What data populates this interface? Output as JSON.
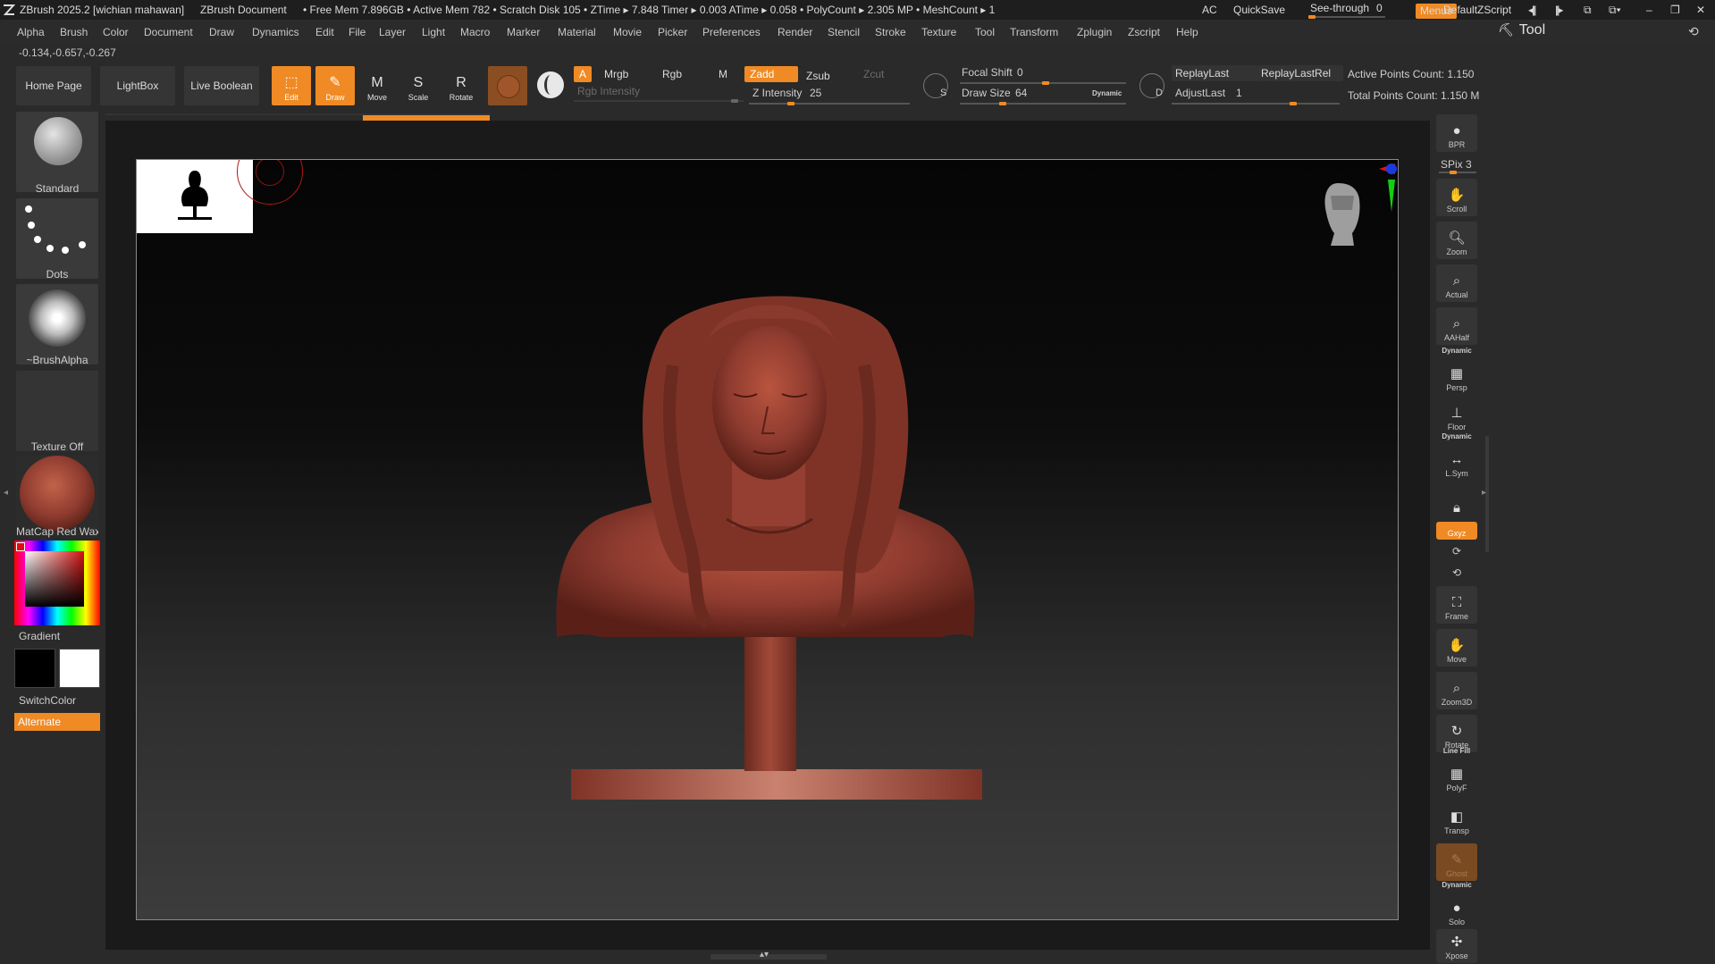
{
  "titlebar": {
    "app_title": "ZBrush 2025.2 [wichian mahawan]",
    "document": "ZBrush Document",
    "stats": "• Free Mem 7.896GB • Active Mem 782 • Scratch Disk 105 • ZTime ▸ 7.848 Timer ▸ 0.003 ATime ▸ 0.058 • PolyCount ▸ 2.305 MP • MeshCount ▸ 1",
    "ac": "AC",
    "quicksave": "QuickSave",
    "see_through_label": "See-through",
    "see_through_value": "0",
    "see_through_fraction": 0.0,
    "menus": "Menus",
    "script": "DefaultZScript"
  },
  "menubar": {
    "items": [
      "Alpha",
      "Brush",
      "Color",
      "Document",
      "Draw",
      "Dynamics",
      "Edit",
      "File",
      "Layer",
      "Light",
      "Macro",
      "Marker",
      "Material",
      "Movie",
      "Picker",
      "Preferences",
      "Render",
      "Stencil",
      "Stroke",
      "Texture",
      "Tool",
      "Transform",
      "Zplugin",
      "Zscript",
      "Help"
    ]
  },
  "tool_panel_title": "Tool",
  "coords": "-0.134,-0.657,-0.267",
  "shelf": {
    "home_page": "Home Page",
    "lightbox": "LightBox",
    "live_boolean": "Live Boolean",
    "edit": "Edit",
    "draw": "Draw",
    "move": "Move",
    "scale": "Scale",
    "rotate": "Rotate",
    "a": "A",
    "mrgb": "Mrgb",
    "rgb": "Rgb",
    "m": "M",
    "rgb_intensity": "Rgb Intensity",
    "zadd": "Zadd",
    "zsub": "Zsub",
    "zcut": "Zcut",
    "z_intensity_label": "Z Intensity",
    "z_intensity_value": "25",
    "z_intensity_fraction": 0.25,
    "focal_shift_label": "Focal Shift",
    "focal_shift_value": "0",
    "draw_size_label": "Draw Size",
    "draw_size_value": "64",
    "dynamic": "Dynamic",
    "s_label": "S",
    "d_label": "D",
    "replay_last": "ReplayLast",
    "replay_last_rel": "ReplayLastRel",
    "adjust_last_label": "AdjustLast",
    "adjust_last_value": "1",
    "active_points": "Active Points Count: 1.150",
    "total_points": "Total Points Count: 1.150 M"
  },
  "left": {
    "brush": "Standard",
    "stroke": "Dots",
    "alpha": "~BrushAlpha",
    "texture": "Texture Off",
    "material": "MatCap Red Wax",
    "gradient": "Gradient",
    "switch_color": "SwitchColor",
    "alternate": "Alternate"
  },
  "right": {
    "bpr": "BPR",
    "spix_label": "SPix",
    "spix_value": "3",
    "scroll": "Scroll",
    "zoom": "Zoom",
    "actual": "Actual",
    "aahalf": "AAHalf",
    "dynamic": "Dynamic",
    "persp": "Persp",
    "floor": "Floor",
    "lsym": "L.Sym",
    "xyz": "Gxyz",
    "frame": "Frame",
    "move": "Move",
    "zoom3d": "Zoom3D",
    "rotate": "Rotate",
    "line_fill": "Line Fill",
    "polyf": "PolyF",
    "transp": "Transp",
    "ghost": "Ghost",
    "solo": "Solo",
    "xpose": "Xpose"
  },
  "colors": {
    "accent": "#f08a24",
    "model": "#8e3b2f",
    "primary_color": "#000000",
    "secondary_color": "#ffffff"
  }
}
